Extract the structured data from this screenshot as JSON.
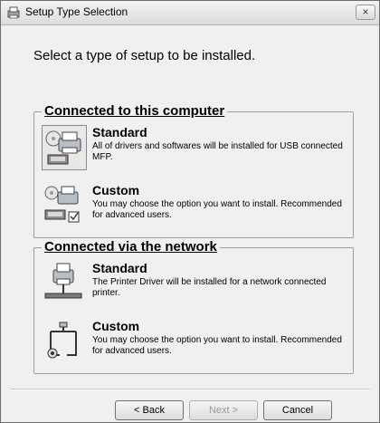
{
  "window": {
    "title": "Setup Type Selection",
    "close_label": "×"
  },
  "header": "Select a type of setup to be installed.",
  "groups": [
    {
      "legend": "Connected to this computer",
      "options": [
        {
          "title": "Standard",
          "description": "All of drivers and softwares will be installed for USB connected MFP.",
          "icon": "usb-standard-printer-icon",
          "selected": true
        },
        {
          "title": "Custom",
          "description": "You may choose the option you want to install. Recommended for advanced users.",
          "icon": "usb-custom-printer-icon",
          "selected": false
        }
      ]
    },
    {
      "legend": "Connected via the network",
      "options": [
        {
          "title": "Standard",
          "description": "The Printer Driver will be installed for a network connected printer.",
          "icon": "network-standard-printer-icon",
          "selected": false
        },
        {
          "title": "Custom",
          "description": "You may choose the option you want to install. Recommended for advanced users.",
          "icon": "network-custom-icon",
          "selected": false
        }
      ]
    }
  ],
  "buttons": {
    "back": "< Back",
    "next": "Next >",
    "cancel": "Cancel"
  }
}
